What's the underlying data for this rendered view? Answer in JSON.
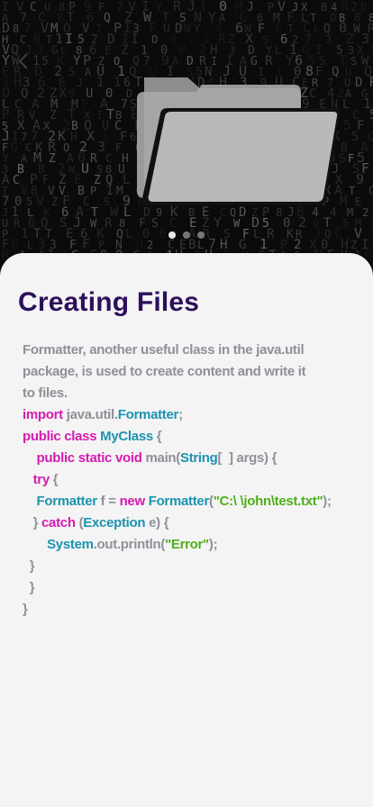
{
  "intro": {
    "title": "Creating Files",
    "description": "Formatter, another useful class in the java.util package, is used to create content and write it to files."
  },
  "carousel": {
    "total": 3,
    "active_index": 0
  },
  "icons": {
    "back": "chevron-left-icon",
    "hero": "folder-icon"
  },
  "colors": {
    "title": "#2d0f5c",
    "text": "#8f8f9a",
    "keyword": "#d61bb0",
    "type": "#1d93b0",
    "string": "#4fae1b",
    "card_bg": "#f4f4f4"
  },
  "code": [
    [
      {
        "t": "import",
        "c": "kw"
      },
      {
        "t": " java.util."
      },
      {
        "t": "Formatter",
        "c": "ty"
      },
      {
        "t": ";"
      }
    ],
    [
      {
        "t": "public class ",
        "c": "kw"
      },
      {
        "t": "MyClass",
        "c": "ty"
      },
      {
        "t": " {"
      }
    ],
    [
      {
        "t": "    "
      },
      {
        "t": "public static void ",
        "c": "kw"
      },
      {
        "t": "main("
      },
      {
        "t": "String",
        "c": "ty"
      },
      {
        "t": "[  ] args) {"
      }
    ],
    [
      {
        "t": "   "
      },
      {
        "t": "try",
        "c": "kw"
      },
      {
        "t": " {"
      }
    ],
    [
      {
        "t": "    "
      },
      {
        "t": "Formatter",
        "c": "ty"
      },
      {
        "t": " f = "
      },
      {
        "t": "new ",
        "c": "kw"
      },
      {
        "t": "Formatter",
        "c": "ty"
      },
      {
        "t": "("
      },
      {
        "t": "\"C:\\ \\john\\test.txt\"",
        "c": "st"
      },
      {
        "t": ");"
      }
    ],
    [
      {
        "t": "   } "
      },
      {
        "t": "catch",
        "c": "kw"
      },
      {
        "t": " ("
      },
      {
        "t": "Exception",
        "c": "ty"
      },
      {
        "t": " e) {"
      }
    ],
    [
      {
        "t": "       "
      },
      {
        "t": "System",
        "c": "ty"
      },
      {
        "t": ".out.println("
      },
      {
        "t": "\"Error\"",
        "c": "st"
      },
      {
        "t": ");"
      }
    ],
    [
      {
        "t": "  }"
      }
    ],
    [
      {
        "t": "  }"
      }
    ],
    [
      {
        "t": "}"
      }
    ]
  ]
}
